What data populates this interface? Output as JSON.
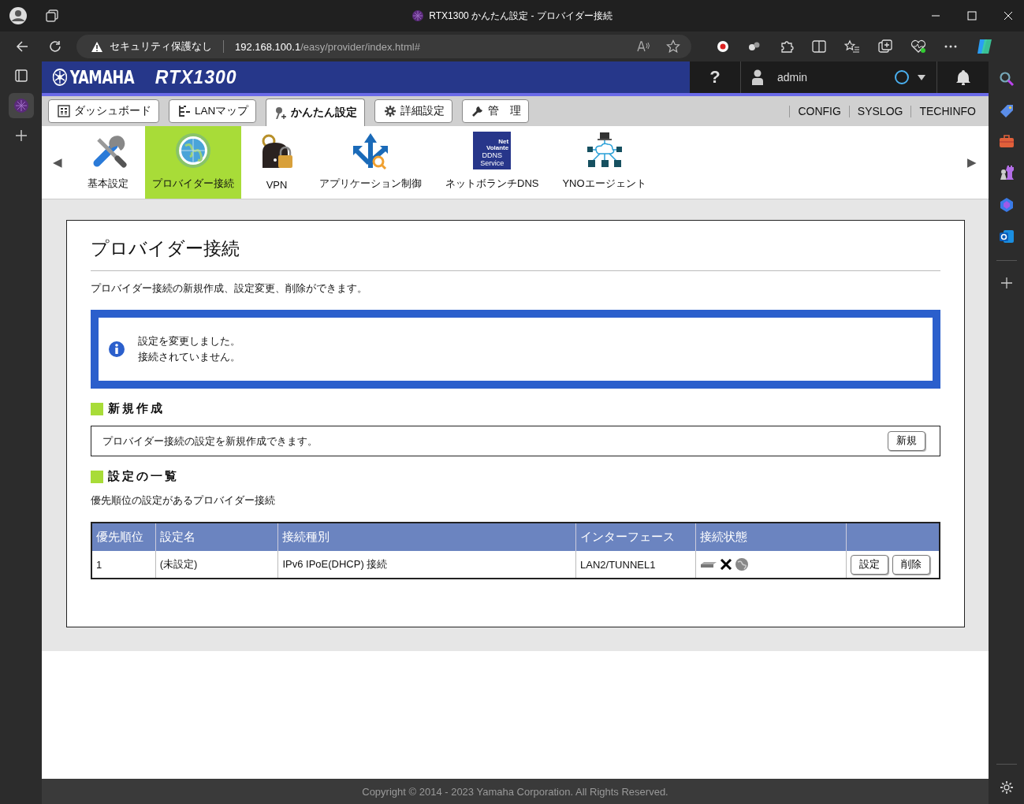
{
  "browser": {
    "tab_title": "RTX1300 かんたん設定 - プロバイダー接続",
    "security_label": "セキュリティ保護なし",
    "url_host": "192.168.100.1",
    "url_path": "/easy/provider/index.html#"
  },
  "header": {
    "logo": "YAMAHA",
    "model": "RTX1300",
    "help": "?",
    "user": "admin"
  },
  "tabs": [
    {
      "label": "ダッシュボード",
      "selected": false
    },
    {
      "label": "LANマップ",
      "selected": false
    },
    {
      "label": "かんたん設定",
      "selected": true
    },
    {
      "label": "詳細設定",
      "selected": false
    },
    {
      "label": "管　理",
      "selected": false
    }
  ],
  "links": [
    "CONFIG",
    "SYSLOG",
    "TECHINFO"
  ],
  "menu": {
    "prev": "◀",
    "next": "▶",
    "items": [
      {
        "label": "基本設定",
        "selected": false
      },
      {
        "label": "プロバイダー接続",
        "selected": true
      },
      {
        "label": "VPN",
        "selected": false
      },
      {
        "label": "アプリケーション制御",
        "selected": false
      },
      {
        "label": "ネットボランチDNS",
        "selected": false,
        "icon_text": [
          "Net",
          "Volante",
          "DDNS",
          "Service"
        ]
      },
      {
        "label": "YNOエージェント",
        "selected": false
      }
    ]
  },
  "page": {
    "title": "プロバイダー接続",
    "description": "プロバイダー接続の新規作成、設定変更、削除ができます。",
    "notice": [
      "設定を変更しました。",
      "接続されていません。"
    ],
    "new_section": {
      "heading": "新規作成",
      "text": "プロバイダー接続の設定を新規作成できます。",
      "button": "新規"
    },
    "list_section": {
      "heading": "設定の一覧",
      "caption": "優先順位の設定があるプロバイダー接続"
    }
  },
  "table": {
    "columns": [
      "優先順位",
      "設定名",
      "接続種別",
      "インターフェース",
      "接続状態"
    ],
    "rows": [
      {
        "cells": [
          "1",
          "(未設定)",
          "IPv6 IPoE(DHCP) 接続",
          "LAN2/TUNNEL1"
        ],
        "connected": false,
        "buttons": [
          "設定",
          "削除"
        ]
      }
    ]
  },
  "footer": "Copyright © 2014 - 2023 Yamaha Corporation. All Rights Reserved."
}
